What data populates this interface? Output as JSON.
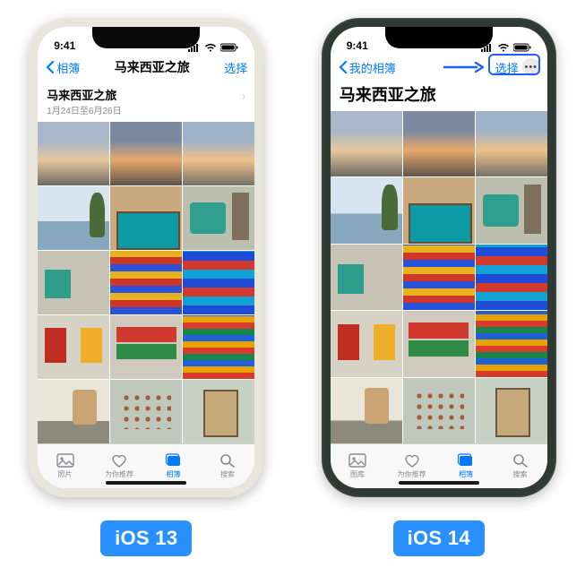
{
  "left": {
    "status_time": "9:41",
    "back_label": "相簿",
    "nav_title": "马来西亚之旅",
    "select_label": "选择",
    "album_title": "马来西亚之旅",
    "album_subtitle": "1月24日至6月26日",
    "tabs": [
      "照片",
      "为你推荐",
      "相簿",
      "搜索"
    ],
    "active_tab_index": 2,
    "badge": "iOS 13"
  },
  "right": {
    "status_time": "9:41",
    "back_label": "我的相簿",
    "select_label": "选择",
    "album_title": "马来西亚之旅",
    "tabs": [
      "图库",
      "为你推荐",
      "相簿",
      "搜索"
    ],
    "active_tab_index": 2,
    "badge": "iOS 14"
  }
}
